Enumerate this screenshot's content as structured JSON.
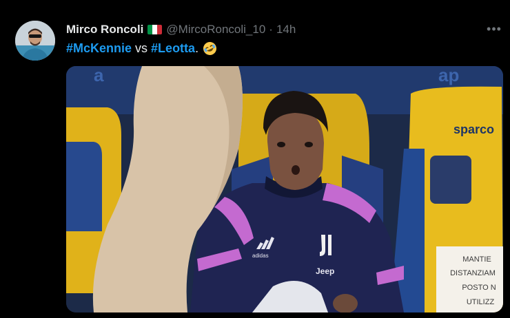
{
  "tweet": {
    "author": {
      "display_name": "Mirco Roncoli",
      "flag_icon": "italy-flag-icon",
      "handle": "@MircoRoncoli_10",
      "separator": "·",
      "timestamp": "14h",
      "avatar_icon": "avatar-image"
    },
    "more_label": "•••",
    "text": {
      "hashtag_1": "#McKennie",
      "word": " vs ",
      "hashtag_2": "#Leotta",
      "period": ".",
      "emoji_icon": "rolling-on-floor-laughing-emoji"
    },
    "media": {
      "type": "photo",
      "seat_logo": "sparco",
      "kit_brand": "adidas",
      "shirt_sponsor": "Jeep",
      "notice_lines": [
        "MANTIE",
        "DISTANZIAM",
        "POSTO N",
        "UTILIZZ"
      ]
    }
  },
  "colors": {
    "background": "#000000",
    "text_primary": "#e7e9ea",
    "text_secondary": "#71767b",
    "link": "#1d9bf0",
    "flag": [
      "#009246",
      "#ffffff",
      "#ce2b37"
    ]
  }
}
